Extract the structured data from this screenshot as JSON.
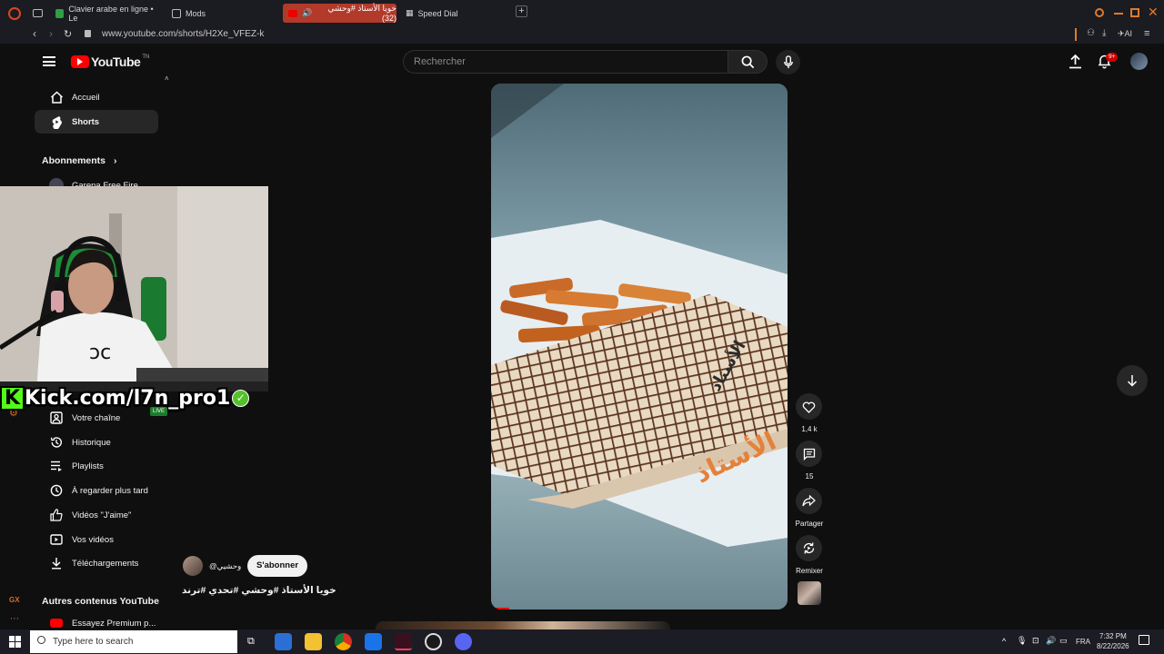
{
  "browser": {
    "tabs": [
      {
        "label": "Clavier arabe en ligne • Le",
        "active": false
      },
      {
        "label": "Mods",
        "active": false
      },
      {
        "label": "خويا الأستاذ #وحشي (32)",
        "active": true
      },
      {
        "label": "Speed Dial",
        "active": false
      }
    ],
    "url": "www.youtube.com/shorts/H2Xe_VFEZ-k",
    "ai_label": "AI",
    "notif_count": "9+"
  },
  "youtube": {
    "logo_text": "YouTube",
    "logo_region": "TN",
    "search_placeholder": "Rechercher"
  },
  "sidebar": {
    "top_items": [
      {
        "label": "Accueil",
        "icon": "home-icon"
      },
      {
        "label": "Shorts",
        "icon": "shorts-icon"
      }
    ],
    "subscriptions_heading": "Abonnements",
    "subscriptions": [
      {
        "label": "Garena Free Fire"
      }
    ],
    "you_items": [
      {
        "label": "Votre chaîne",
        "icon": "channel-icon"
      },
      {
        "label": "Historique",
        "icon": "history-icon"
      },
      {
        "label": "Playlists",
        "icon": "playlist-icon"
      },
      {
        "label": "À regarder plus tard",
        "icon": "clock-icon"
      },
      {
        "label": "Vidéos \"J'aime\"",
        "icon": "thumb-up-icon"
      },
      {
        "label": "Vos vidéos",
        "icon": "video-icon"
      },
      {
        "label": "Téléchargements",
        "icon": "download-icon"
      }
    ],
    "more_heading": "Autres contenus YouTube",
    "more_items": [
      {
        "label": "Essayez Premium p...",
        "icon": "youtube-premium-icon"
      }
    ]
  },
  "overlay": {
    "kick_text": "Kick.com/l7n_pro1",
    "live_label": "LIVE"
  },
  "short": {
    "channel": "@وحشيي",
    "subscribe_label": "S'abonner",
    "title": "خويا الأستاذ #وحشي #تحدي #ترند",
    "actions": {
      "likes": "1,4 k",
      "comments": "15",
      "share": "Partager",
      "remix": "Remixer"
    }
  },
  "taskbar": {
    "search_placeholder": "Type here to search",
    "language": "FRA",
    "time": "7:32 PM",
    "date": "8/22/2026"
  }
}
